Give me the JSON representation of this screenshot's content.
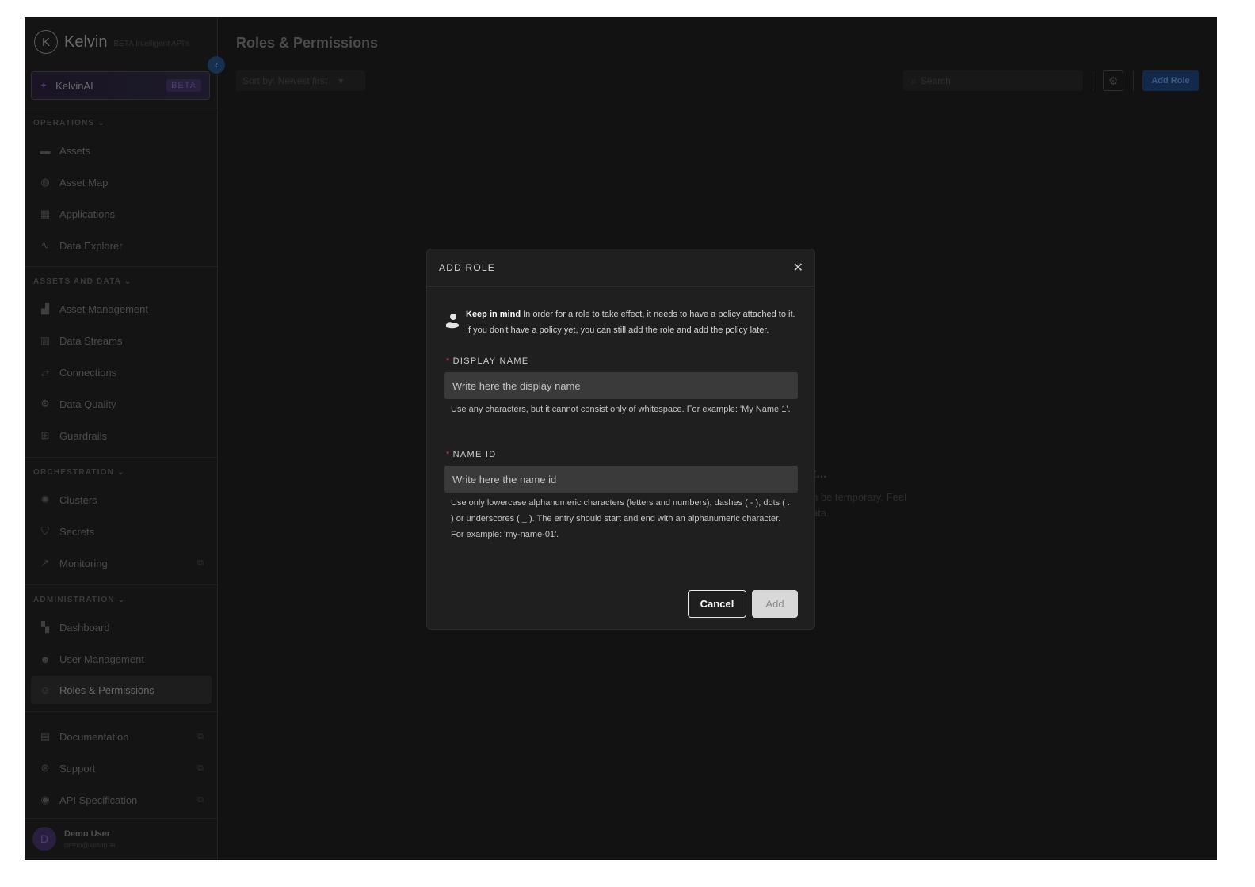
{
  "brand": {
    "name": "Kelvin",
    "tag": "BETA Intelligent API's",
    "logo_letter": "K"
  },
  "kelvin_ai": {
    "label": "KelvinAI",
    "badge": "BETA"
  },
  "sidebar": {
    "sections": [
      {
        "title": "OPERATIONS",
        "items": [
          {
            "label": "Assets",
            "icon": "assets-icon"
          },
          {
            "label": "Asset Map",
            "icon": "globe-icon"
          },
          {
            "label": "Applications",
            "icon": "apps-icon"
          },
          {
            "label": "Data Explorer",
            "icon": "pulse-icon"
          }
        ]
      },
      {
        "title": "ASSETS AND DATA",
        "items": [
          {
            "label": "Asset Management",
            "icon": "asset-management-icon"
          },
          {
            "label": "Data Streams",
            "icon": "chart-icon"
          },
          {
            "label": "Connections",
            "icon": "connections-icon"
          },
          {
            "label": "Data Quality",
            "icon": "gear-icon"
          },
          {
            "label": "Guardrails",
            "icon": "barrier-icon"
          }
        ]
      },
      {
        "title": "ORCHESTRATION",
        "items": [
          {
            "label": "Clusters",
            "icon": "cluster-icon"
          },
          {
            "label": "Secrets",
            "icon": "shield-icon"
          },
          {
            "label": "Monitoring",
            "icon": "monitoring-icon"
          }
        ]
      },
      {
        "title": "ADMINISTRATION",
        "items": [
          {
            "label": "Dashboard",
            "icon": "dashboard-icon"
          },
          {
            "label": "User Management",
            "icon": "users-icon"
          },
          {
            "label": "Roles & Permissions",
            "icon": "roles-icon",
            "active": true
          }
        ]
      }
    ],
    "bottom_items": [
      {
        "label": "Documentation",
        "icon": "document-icon"
      },
      {
        "label": "Support",
        "icon": "lifebuoy-icon"
      },
      {
        "label": "API Specification",
        "icon": "api-icon"
      }
    ]
  },
  "user": {
    "initial": "D",
    "name": "Demo User",
    "email": "demo@kelvin.ai"
  },
  "main": {
    "title": "Roles & Permissions",
    "sort_label": "Sort by: Newest first",
    "search_placeholder": "Search",
    "add_role_label": "Add Role",
    "empty_title": "t...",
    "empty_text": "n be temporary. Feel ata."
  },
  "modal": {
    "title": "ADD ROLE",
    "close_glyph": "✕",
    "info_bold": "Keep in mind",
    "info_text": " In order for a role to take effect, it needs to have a policy attached to it. If you don't have a policy yet, you can still add the role and add the policy later.",
    "display_name": {
      "label": "DISPLAY NAME",
      "placeholder": "Write here the display name",
      "hint": "Use any characters, but it cannot consist only of whitespace. For example: 'My Name 1'."
    },
    "name_id": {
      "label": "NAME ID",
      "placeholder": "Write here the name id",
      "hint": "Use only lowercase alphanumeric characters (letters and numbers), dashes ( - ), dots ( . ) or underscores ( _ ). The entry should start and end with an alphanumeric character. For example: 'my-name-01'."
    },
    "required_mark": "*",
    "cancel_label": "Cancel",
    "add_label": "Add"
  }
}
